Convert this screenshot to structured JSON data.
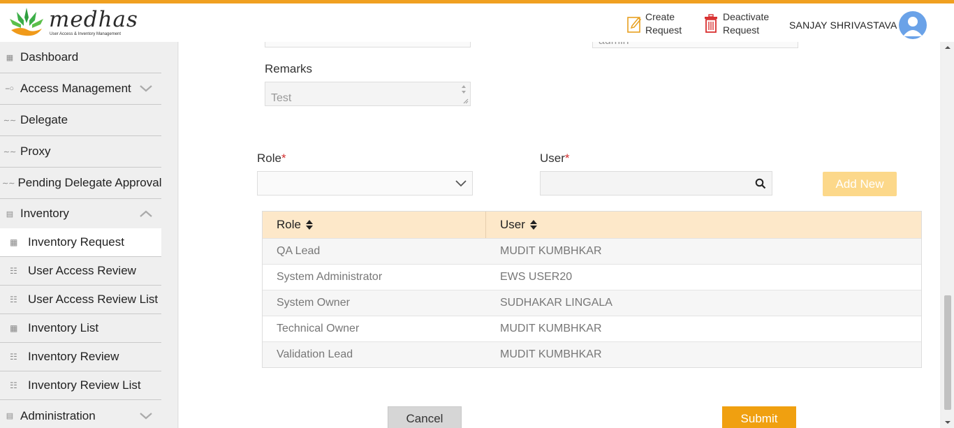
{
  "brand": {
    "name": "medhas",
    "tagline": "User Access & Inventory Management"
  },
  "header": {
    "create_request": "Create\nRequest",
    "deactivate_request": "Deactivate\nRequest",
    "user_name": "SANJAY SHRIVASTAVA"
  },
  "sidebar": {
    "items": [
      {
        "label": "Dashboard"
      },
      {
        "label": "Access Management"
      },
      {
        "label": "Delegate"
      },
      {
        "label": "Proxy"
      },
      {
        "label": "Pending Delegate Approval"
      },
      {
        "label": "Inventory"
      },
      {
        "label": "Administration"
      }
    ],
    "inventory_subitems": [
      {
        "label": "Inventory Request"
      },
      {
        "label": "User Access Review"
      },
      {
        "label": "User Access Review List"
      },
      {
        "label": "Inventory List"
      },
      {
        "label": "Inventory Review"
      },
      {
        "label": "Inventory Review List"
      }
    ]
  },
  "form": {
    "partial_field_value": "admin",
    "remarks_label": "Remarks",
    "remarks_value": "Test",
    "role_label": "Role",
    "user_label": "User",
    "required_mark": "*",
    "add_new": "Add New"
  },
  "table": {
    "headers": [
      "Role",
      "User"
    ],
    "rows": [
      {
        "role": "QA Lead",
        "user": "MUDIT KUMBHKAR"
      },
      {
        "role": "System Administrator",
        "user": "EWS USER20"
      },
      {
        "role": "System Owner",
        "user": "SUDHAKAR LINGALA"
      },
      {
        "role": "Technical Owner",
        "user": "MUDIT KUMBHKAR"
      },
      {
        "role": "Validation Lead",
        "user": "MUDIT KUMBHKAR"
      }
    ]
  },
  "actions": {
    "cancel": "Cancel",
    "submit": "Submit"
  },
  "colors": {
    "accent": "#f0a020",
    "table_header": "#fde8c9",
    "add_new_button": "#fcd88a",
    "submit_button": "#f0a010"
  }
}
